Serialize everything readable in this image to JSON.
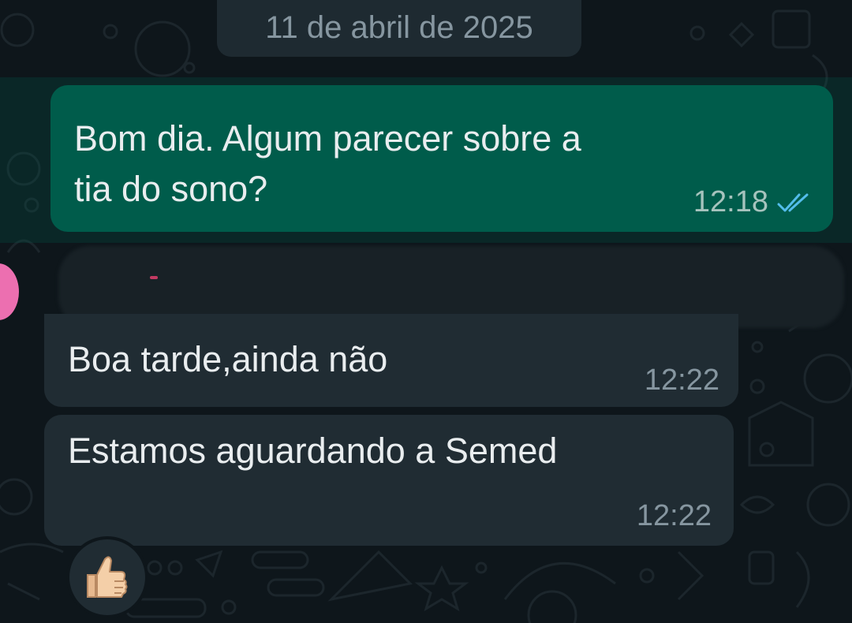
{
  "date_separator": "11 de abril de 2025",
  "messages": [
    {
      "direction": "outgoing",
      "lines": [
        "Bom dia. Algum parecer sobre a",
        "tia do sono?"
      ],
      "time": "12:18",
      "status": "read"
    },
    {
      "direction": "incoming",
      "sender_redacted": true,
      "text": "Boa tarde,ainda não",
      "time": "12:22"
    },
    {
      "direction": "incoming",
      "text": "Estamos aguardando a Semed",
      "time": "12:22",
      "reaction": "thumbs-up"
    }
  ],
  "colors": {
    "outgoing_bubble": "#005c4b",
    "incoming_bubble": "#202c33",
    "read_ticks": "#53bdeb",
    "timestamp": "#8696a0"
  }
}
